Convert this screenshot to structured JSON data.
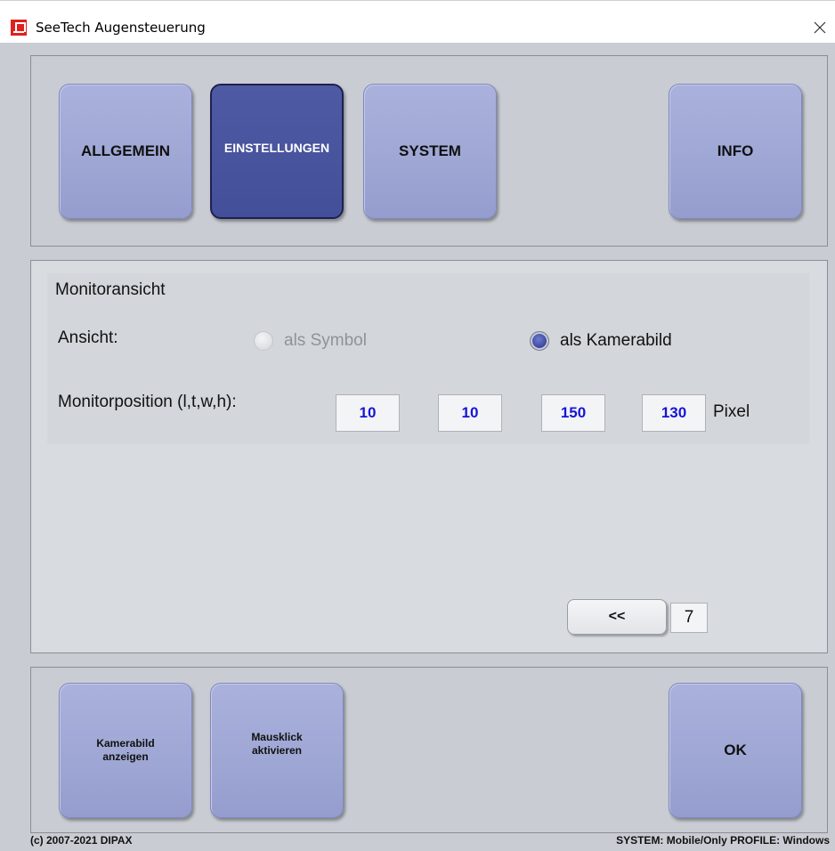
{
  "window": {
    "title": "SeeTech Augensteuerung",
    "icon": "app-logo-icon",
    "close_icon": "close-icon"
  },
  "tabs": [
    {
      "label": "ALLGEMEIN",
      "active": false
    },
    {
      "label": "EINSTELLUNGEN",
      "active": true
    },
    {
      "label": "SYSTEM",
      "active": false
    },
    {
      "label": "INFO",
      "active": false
    }
  ],
  "settings": {
    "section_title": "Monitoransicht",
    "view_label": "Ansicht:",
    "view_options": [
      {
        "label": "als Symbol",
        "selected": false
      },
      {
        "label": "als Kamerabild",
        "selected": true
      }
    ],
    "position_label": "Monitorposition (l,t,w,h):",
    "position_values": [
      "10",
      "10",
      "150",
      "130"
    ],
    "position_unit": "Pixel"
  },
  "pager": {
    "back_label": "<<",
    "page": "7"
  },
  "actions": [
    {
      "label": "Kamerabild\nanzeigen"
    },
    {
      "label": "Mausklick\naktivieren"
    },
    {
      "label": "OK"
    }
  ],
  "footer": {
    "copyright": "(c) 2007-2021 DIPAX",
    "status": "SYSTEM: Mobile/Only  PROFILE: Windows"
  },
  "colors": {
    "button": "#9ea6d4",
    "button_active": "#434f98",
    "value_text": "#1515d8",
    "background": "#c9cdd3"
  }
}
